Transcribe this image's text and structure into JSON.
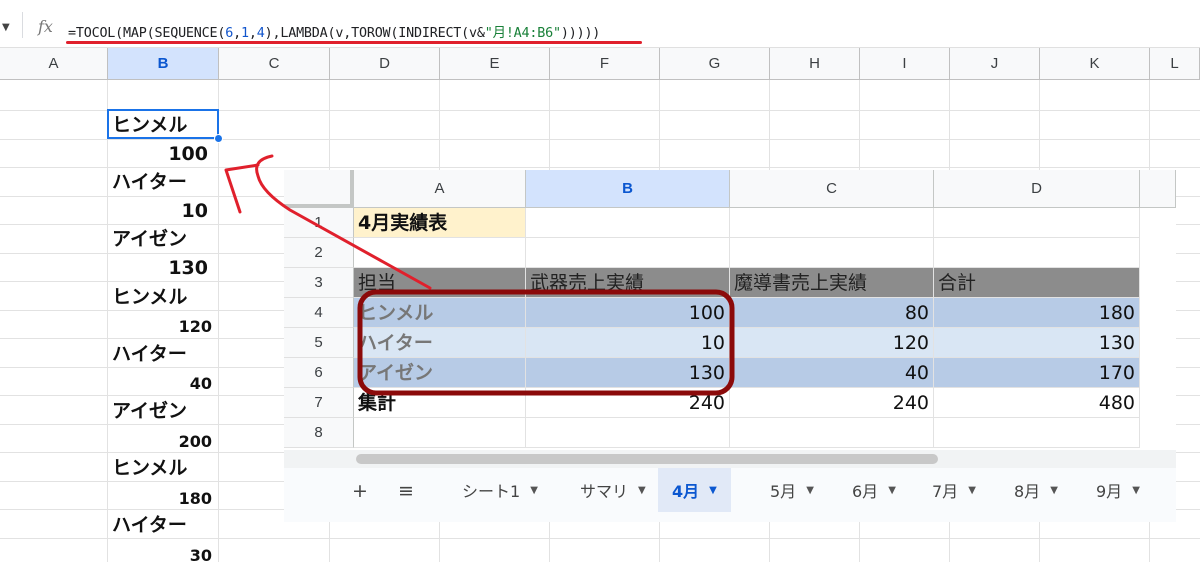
{
  "formula_bar": {
    "fx_label": "fx",
    "formula_parts": [
      {
        "text": "=TOCOL(MAP(SEQUENCE(",
        "kind": "plain"
      },
      {
        "text": "6",
        "kind": "num"
      },
      {
        "text": ",",
        "kind": "plain"
      },
      {
        "text": "1",
        "kind": "num"
      },
      {
        "text": ",",
        "kind": "plain"
      },
      {
        "text": "4",
        "kind": "num"
      },
      {
        "text": "),LAMBDA(v,TOROW(INDIRECT(v&",
        "kind": "plain"
      },
      {
        "text": "\"月!A4:B6\"",
        "kind": "str"
      },
      {
        "text": ")))))",
        "kind": "plain"
      }
    ]
  },
  "sheet": {
    "columns": [
      "A",
      "B",
      "C",
      "D",
      "E",
      "F",
      "G",
      "H",
      "I",
      "J",
      "K",
      "L"
    ],
    "selected_column": "B",
    "column_b_values": [
      "ヒンメル",
      "100",
      "ハイター",
      "10",
      "アイゼン",
      "130",
      "ヒンメル",
      "120",
      "ハイター",
      "40",
      "アイゼン",
      "200",
      "ヒンメル",
      "180",
      "ハイター",
      "30"
    ]
  },
  "inset": {
    "columns": [
      "A",
      "B",
      "C",
      "D"
    ],
    "selected_column": "B",
    "rows": [
      "1",
      "2",
      "3",
      "4",
      "5",
      "6",
      "7",
      "8"
    ],
    "title": "4月実績表",
    "header": [
      "担当",
      "武器売上実績",
      "魔導書売上実績",
      "合計"
    ],
    "data": [
      [
        "ヒンメル",
        "100",
        "80",
        "180"
      ],
      [
        "ハイター",
        "10",
        "120",
        "130"
      ],
      [
        "アイゼン",
        "130",
        "40",
        "170"
      ]
    ],
    "total": [
      "集計",
      "240",
      "240",
      "480"
    ],
    "tabs": [
      {
        "label": "シート1",
        "active": false
      },
      {
        "label": "サマリ",
        "active": false
      },
      {
        "label": "4月",
        "active": true
      },
      {
        "label": "5月",
        "active": false
      },
      {
        "label": "6月",
        "active": false
      },
      {
        "label": "7月",
        "active": false
      },
      {
        "label": "8月",
        "active": false
      },
      {
        "label": "9月",
        "active": false
      }
    ],
    "add_sheet": "+",
    "all_sheets": "≡"
  },
  "annotation_colors": {
    "highlight_box": "#8b0a0a",
    "arrow": "#e0202c",
    "underline": "#e0202c"
  }
}
